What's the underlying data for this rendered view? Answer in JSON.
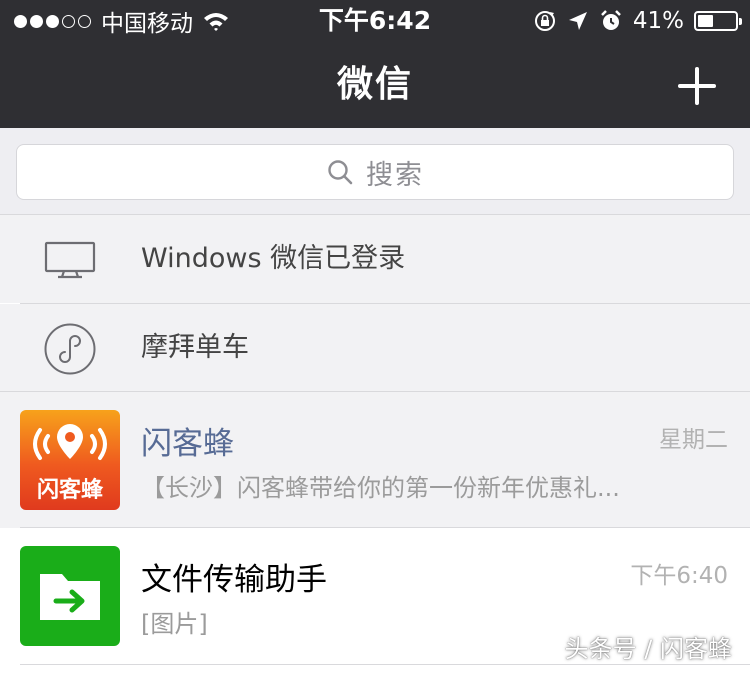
{
  "status_bar": {
    "signal_dots_filled": 3,
    "signal_dots_total": 5,
    "carrier": "中国移动",
    "time": "下午6:42",
    "battery_percent_text": "41%",
    "battery_level": 0.41,
    "icons": [
      "wifi-icon",
      "rotation-lock-icon",
      "location-arrow-icon",
      "alarm-icon",
      "battery-icon"
    ]
  },
  "nav_bar": {
    "title": "微信",
    "add_icon": "plus-icon"
  },
  "search": {
    "placeholder": "搜索",
    "icon": "search-icon"
  },
  "special_rows": [
    {
      "label": "Windows 微信已登录",
      "icon": "monitor-icon"
    },
    {
      "label": "摩拜单车",
      "icon": "mini-program-icon"
    }
  ],
  "chats": [
    {
      "name": "闪客蜂",
      "time": "星期二",
      "message": "【长沙】闪客蜂带给你的第一份新年优惠礼...",
      "avatar_text": "闪客蜂",
      "avatar_color": "#ef5a1f",
      "name_color": "#576b95",
      "pinned": true
    },
    {
      "name": "文件传输助手",
      "time": "下午6:40",
      "message": "[图片]",
      "avatar_icon": "folder-arrow-icon",
      "avatar_color": "#1aad19",
      "name_color": "#000000",
      "pinned": false
    }
  ],
  "watermark": "头条号 / 闪客蜂",
  "colors": {
    "bar_background": "#2f2f33",
    "pinned_background": "#f2f2f4",
    "search_background": "#eeeef2"
  }
}
